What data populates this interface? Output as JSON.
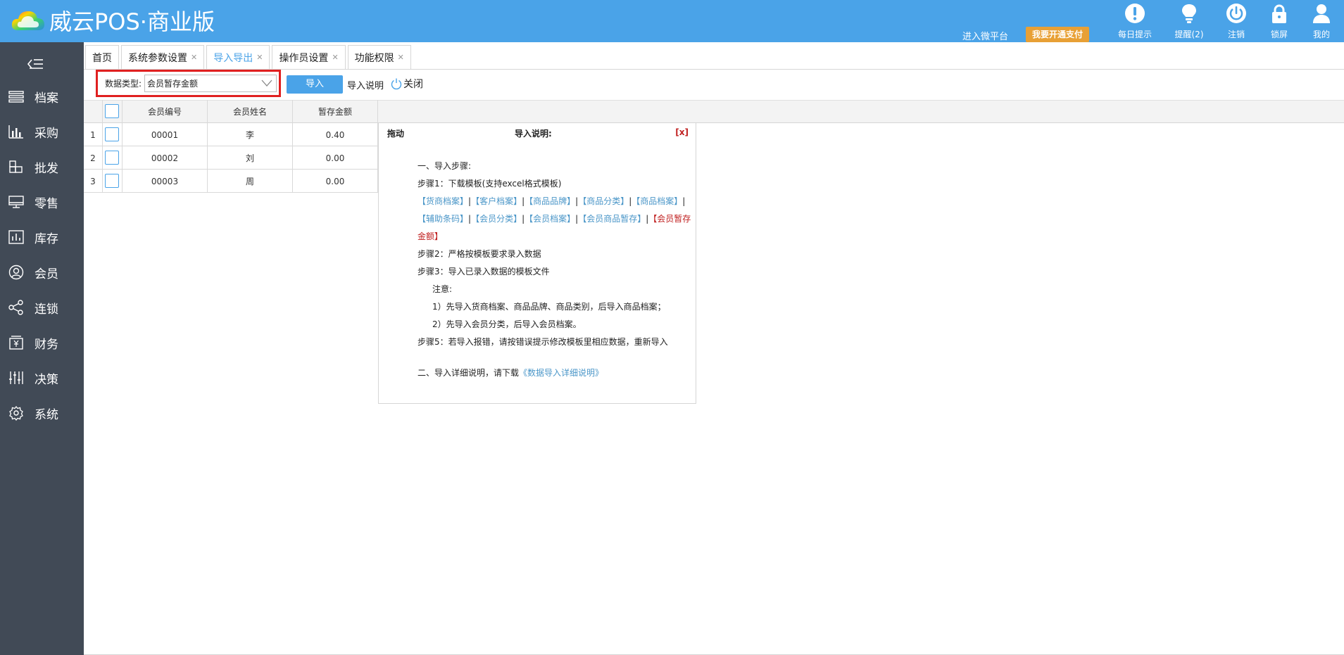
{
  "app": {
    "title": "威云POS·商业版",
    "header_links": {
      "micro_platform": "进入微平台",
      "open_payment": "我要开通支付"
    },
    "header_icons": [
      {
        "label": "每日提示",
        "icon": "exclamation-icon"
      },
      {
        "label": "提醒(2)",
        "icon": "lightbulb-icon"
      },
      {
        "label": "注销",
        "icon": "power-icon"
      },
      {
        "label": "锁屏",
        "icon": "lock-icon"
      },
      {
        "label": "我的",
        "icon": "user-icon"
      }
    ]
  },
  "sidebar": {
    "items": [
      {
        "label": "档案",
        "icon": "list-icon"
      },
      {
        "label": "采购",
        "icon": "bar-chart-icon"
      },
      {
        "label": "批发",
        "icon": "boxes-icon"
      },
      {
        "label": "零售",
        "icon": "monitor-icon"
      },
      {
        "label": "库存",
        "icon": "inventory-chart-icon"
      },
      {
        "label": "会员",
        "icon": "member-icon"
      },
      {
        "label": "连锁",
        "icon": "share-icon"
      },
      {
        "label": "财务",
        "icon": "finance-icon"
      },
      {
        "label": "决策",
        "icon": "sliders-icon"
      },
      {
        "label": "系统",
        "icon": "gear-icon"
      }
    ]
  },
  "tabs": [
    {
      "label": "首页",
      "closable": false
    },
    {
      "label": "系统参数设置",
      "closable": true
    },
    {
      "label": "导入导出",
      "closable": true,
      "active": true
    },
    {
      "label": "操作员设置",
      "closable": true
    },
    {
      "label": "功能权限",
      "closable": true
    }
  ],
  "toolbar": {
    "data_type_label": "数据类型:",
    "data_type_value": "会员暂存金额",
    "import_button": "导入",
    "help_link": "导入说明",
    "close_link": "关闭"
  },
  "grid": {
    "columns": [
      "会员编号",
      "会员姓名",
      "暂存金额"
    ],
    "rows": [
      {
        "no": "1",
        "code": "00001",
        "name": "李",
        "amount": "0.40"
      },
      {
        "no": "2",
        "code": "00002",
        "name": "刘",
        "amount": "0.00"
      },
      {
        "no": "3",
        "code": "00003",
        "name": "周",
        "amount": "0.00"
      }
    ]
  },
  "help_panel": {
    "drag": "拖动",
    "title": "导入说明:",
    "close": "[x]",
    "section1": "一、导入步骤:",
    "step1": "步骤1：下载模板(支持excel格式模板)",
    "templates_line1": [
      "【货商档案】",
      "【客户档案】",
      "【商品品牌】",
      "【商品分类】",
      "【商品档案】"
    ],
    "templates_line2": [
      "【辅助条码】",
      "【会员分类】",
      "【会员档案】",
      "【会员商品暂存】"
    ],
    "template_highlight_a": "【会员暂存",
    "template_highlight_b": "金额】",
    "sep": "|",
    "step2": "步骤2：严格按模板要求录入数据",
    "step3": "步骤3：导入已录入数据的模板文件",
    "note": "注意:",
    "note1": "1）先导入货商档案、商品品牌、商品类别，后导入商品档案；",
    "note2": "2）先导入会员分类，后导入会员档案。",
    "step5": "步骤5：若导入报错，请按错误提示修改模板里相应数据，重新导入",
    "section2": "二、导入详细说明，请下载",
    "section2_link": "《数据导入详细说明》"
  },
  "colors": {
    "header_blue": "#4aa3e8",
    "sidebar": "#414a56",
    "pay_orange": "#e8a035",
    "highlight_red": "#e02020"
  }
}
